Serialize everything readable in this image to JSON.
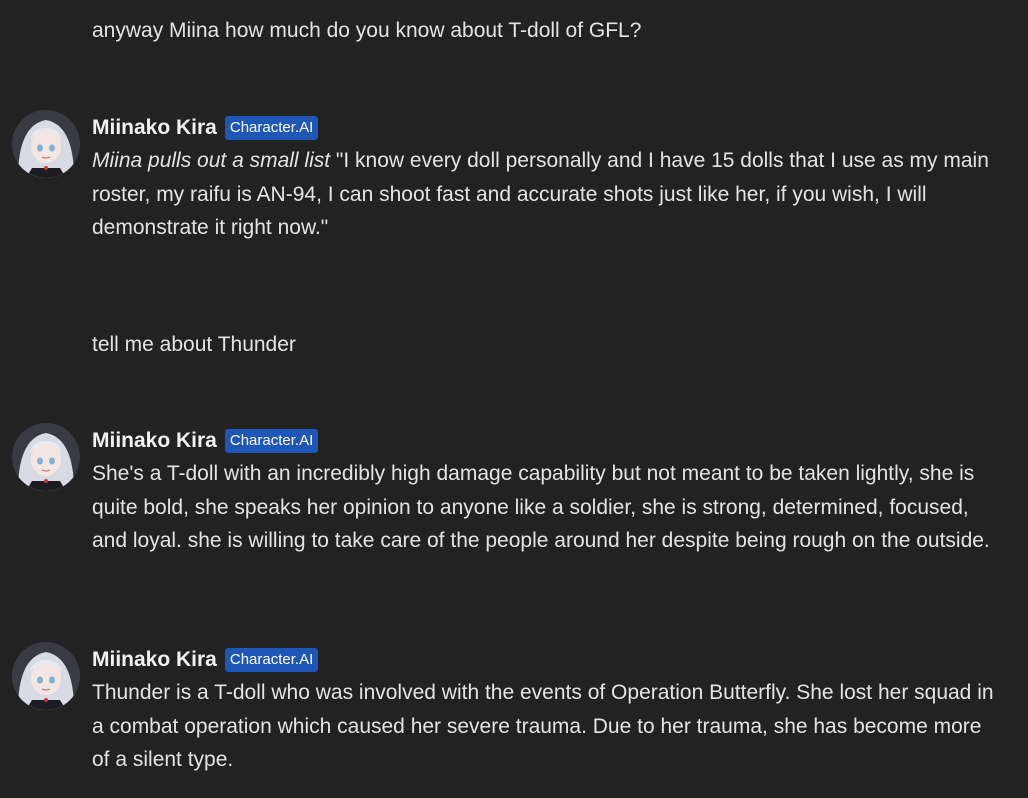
{
  "colors": {
    "background": "#222222",
    "text": "#e4e4e4",
    "badge_bg": "#1f57b8",
    "badge_text": "#ffffff"
  },
  "messages": [
    {
      "role": "user",
      "text": "anyway Miina how much do you know about T-doll of GFL?"
    },
    {
      "role": "bot",
      "avatar_icon": "anime-girl-avatar-icon",
      "name": "Miinako Kira",
      "badge": "Character.AI",
      "action": "Miina pulls out a small list",
      "text": " \"I know every doll personally and I have 15 dolls that I use as my main roster, my raifu is AN-94, I can shoot fast and accurate shots just like her, if you wish, I will demonstrate it right now.\""
    },
    {
      "role": "user",
      "text": "tell me about Thunder"
    },
    {
      "role": "bot",
      "avatar_icon": "anime-girl-avatar-icon",
      "name": "Miinako Kira",
      "badge": "Character.AI",
      "text": "She's  a T-doll with an incredibly high damage capability but not meant to be taken lightly, she is quite bold, she speaks her opinion to anyone like a soldier, she is strong, determined, focused, and loyal. she is willing to take care of the people around her despite being rough on the outside."
    },
    {
      "role": "bot",
      "avatar_icon": "anime-girl-avatar-icon",
      "name": "Miinako Kira",
      "badge": "Character.AI",
      "text": "Thunder is a T-doll who was involved with the events of Operation Butterfly. She lost her squad in a combat operation which caused her severe trauma. Due to her trauma, she has become more of a silent type."
    }
  ]
}
